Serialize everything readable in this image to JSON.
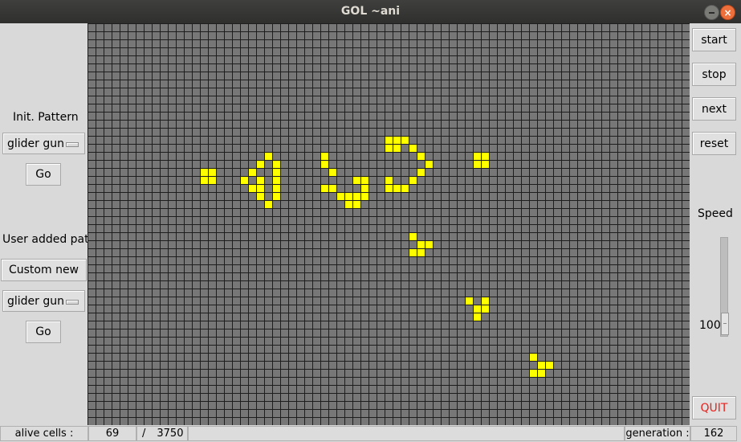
{
  "window": {
    "title": "GOL ~ani"
  },
  "left_panel": {
    "init_label": "Init. Pattern",
    "init_select": "glider gun",
    "init_go": "Go",
    "user_label": "User added patt",
    "custom_new": "Custom new",
    "user_select": "glider gun",
    "user_go": "Go"
  },
  "right_panel": {
    "start": "start",
    "stop": "stop",
    "next": "next",
    "reset": "reset",
    "speed_label": "Speed",
    "speed_value": "100",
    "quit": "QUIT"
  },
  "status": {
    "alive_label": "alive cells :",
    "alive_value": "69",
    "sep": "/",
    "total_value": "3750",
    "generation_label": "generation :",
    "generation_value": "162"
  },
  "grid": {
    "cols": 75,
    "rows": 50,
    "alive_color": "#ffff00",
    "dead_color": "#777777",
    "line_color": "#1e1e1e",
    "alive": [
      [
        14,
        18
      ],
      [
        15,
        18
      ],
      [
        14,
        19
      ],
      [
        15,
        19
      ],
      [
        22,
        16
      ],
      [
        21,
        17
      ],
      [
        23,
        17
      ],
      [
        20,
        18
      ],
      [
        23,
        18
      ],
      [
        19,
        19
      ],
      [
        21,
        19
      ],
      [
        23,
        19
      ],
      [
        20,
        20
      ],
      [
        21,
        20
      ],
      [
        23,
        20
      ],
      [
        21,
        21
      ],
      [
        23,
        21
      ],
      [
        22,
        22
      ],
      [
        29,
        16
      ],
      [
        29,
        17
      ],
      [
        30,
        18
      ],
      [
        29,
        20
      ],
      [
        30,
        20
      ],
      [
        31,
        21
      ],
      [
        32,
        21
      ],
      [
        33,
        21
      ],
      [
        32,
        22
      ],
      [
        33,
        22
      ],
      [
        33,
        19
      ],
      [
        34,
        19
      ],
      [
        34,
        20
      ],
      [
        34,
        21
      ],
      [
        37,
        14
      ],
      [
        38,
        14
      ],
      [
        37,
        15
      ],
      [
        38,
        15
      ],
      [
        37,
        19
      ],
      [
        37,
        20
      ],
      [
        38,
        20
      ],
      [
        39,
        14
      ],
      [
        40,
        15
      ],
      [
        41,
        16
      ],
      [
        42,
        17
      ],
      [
        40,
        19
      ],
      [
        41,
        18
      ],
      [
        39,
        20
      ],
      [
        48,
        16
      ],
      [
        49,
        16
      ],
      [
        48,
        17
      ],
      [
        49,
        17
      ],
      [
        40,
        26
      ],
      [
        41,
        27
      ],
      [
        42,
        27
      ],
      [
        40,
        28
      ],
      [
        41,
        28
      ],
      [
        47,
        34
      ],
      [
        49,
        34
      ],
      [
        48,
        35
      ],
      [
        49,
        35
      ],
      [
        48,
        36
      ],
      [
        55,
        41
      ],
      [
        56,
        42
      ],
      [
        57,
        42
      ],
      [
        55,
        43
      ],
      [
        56,
        43
      ]
    ]
  }
}
